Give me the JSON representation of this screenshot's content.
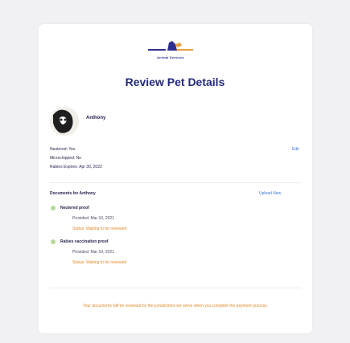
{
  "brand": {
    "logo_text": "Animal Services"
  },
  "page": {
    "title": "Review Pet Details"
  },
  "pet": {
    "name": "Anthony"
  },
  "details": {
    "neutered": "Neutered: Yes",
    "microchipped": "Microchipped: No",
    "rabies_expires": "Rabies Expires: Apr 30, 2022",
    "edit_label": "Edit"
  },
  "documents": {
    "heading": "Documents for Anthony",
    "upload_label": "Upload New",
    "items": [
      {
        "name": "Neutered proof",
        "provided": "Provided: Mar 10, 2021",
        "status": "Status: Waiting to be reviewed"
      },
      {
        "name": "Rabies vaccination proof",
        "provided": "Provided: Mar 10, 2021",
        "status": "Status: Waiting to be reviewed"
      }
    ]
  },
  "footer_note": "Your documents will be reviewed by the jurisdictions we serve when you complete the payment process.",
  "colors": {
    "background": "#f1f1f3",
    "title": "#232a7a",
    "link": "#3a78d8",
    "status": "#e08a2b",
    "bullet": "#b5d99a"
  }
}
